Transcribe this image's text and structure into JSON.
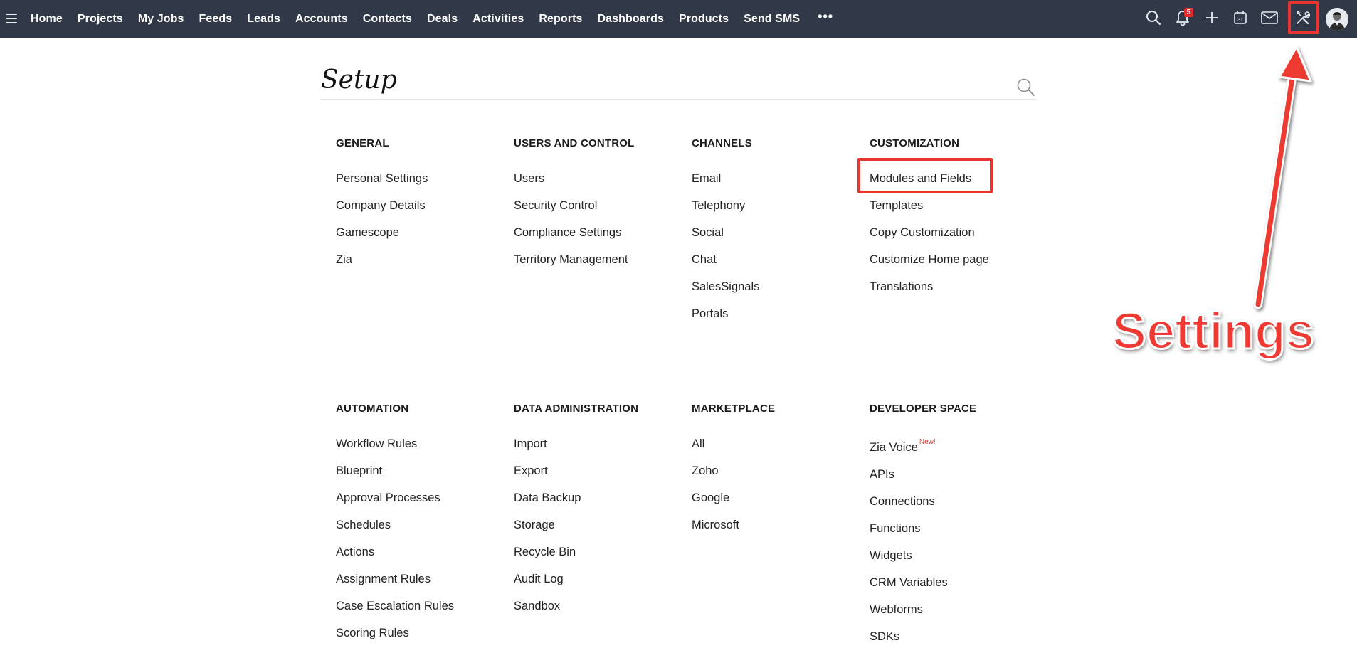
{
  "nav": {
    "items": [
      "Home",
      "Projects",
      "My Jobs",
      "Feeds",
      "Leads",
      "Accounts",
      "Contacts",
      "Deals",
      "Activities",
      "Reports",
      "Dashboards",
      "Products",
      "Send SMS"
    ],
    "more": "•••"
  },
  "topbar_icons": [
    "search-icon",
    "bell-icon",
    "plus-icon",
    "calendar-icon",
    "mail-icon",
    "settings-icon",
    "avatar"
  ],
  "notifications": {
    "count": "5"
  },
  "calendar": {
    "day": "31"
  },
  "page": {
    "title": "Setup"
  },
  "sections": [
    {
      "heading": "GENERAL",
      "links": [
        "Personal Settings",
        "Company Details",
        "Gamescope",
        "Zia"
      ]
    },
    {
      "heading": "USERS AND CONTROL",
      "links": [
        "Users",
        "Security Control",
        "Compliance Settings",
        "Territory Management"
      ]
    },
    {
      "heading": "CHANNELS",
      "links": [
        "Email",
        "Telephony",
        "Social",
        "Chat",
        "SalesSignals",
        "Portals"
      ]
    },
    {
      "heading": "CUSTOMIZATION",
      "links": [
        "Modules and Fields",
        "Templates",
        "Copy Customization",
        "Customize Home page",
        "Translations"
      ]
    },
    {
      "heading": "AUTOMATION",
      "links": [
        "Workflow Rules",
        "Blueprint",
        "Approval Processes",
        "Schedules",
        "Actions",
        "Assignment Rules",
        "Case Escalation Rules",
        "Scoring Rules"
      ]
    },
    {
      "heading": "DATA ADMINISTRATION",
      "links": [
        "Import",
        "Export",
        "Data Backup",
        "Storage",
        "Recycle Bin",
        "Audit Log",
        "Sandbox"
      ]
    },
    {
      "heading": "MARKETPLACE",
      "links": [
        "All",
        "Zoho",
        "Google",
        "Microsoft"
      ]
    },
    {
      "heading": "DEVELOPER SPACE",
      "links": [
        "Zia Voice",
        "APIs",
        "Connections",
        "Functions",
        "Widgets",
        "CRM Variables",
        "Webforms",
        "SDKs"
      ]
    }
  ],
  "zia_voice_tag": "New!",
  "annotation": {
    "label": "Settings",
    "color": "#ee3a32"
  },
  "colors": {
    "topbar": "#313949",
    "highlight": "#e8352f",
    "badge": "#e52a2a"
  }
}
